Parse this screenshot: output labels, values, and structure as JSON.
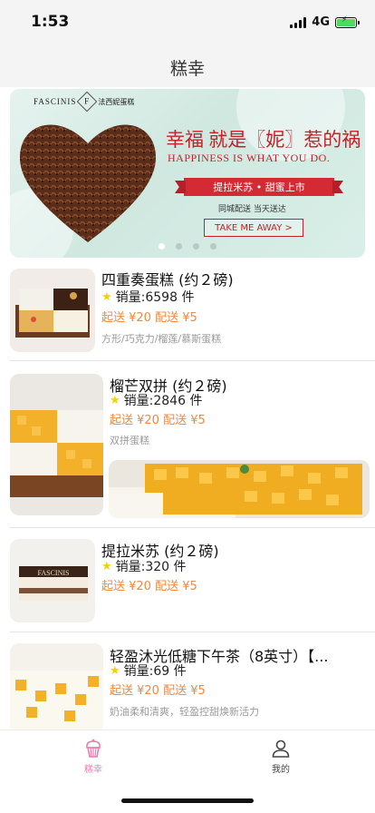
{
  "status_bar": {
    "time": "1:53",
    "network": "4G",
    "battery_level": 0.95,
    "charging": true
  },
  "nav": {
    "title": "糕幸"
  },
  "banner": {
    "brand_en": "FASCINIS",
    "brand_mark": "F",
    "brand_cn": "法西妮蛋糕",
    "slogan": "幸福 就是〖妮〗惹的祸",
    "slogan_en": "HAPPINESS IS WHAT YOU DO.",
    "ribbon": "提拉米苏 • 甜蜜上市",
    "delivery": "同城配送 当天送达",
    "button": "TAKE ME AWAY >",
    "page_count": 4,
    "active_page": 1,
    "colors": {
      "accent": "#c8202a",
      "background": "#d6ede6"
    }
  },
  "products": [
    {
      "title": "四重奏蛋糕 (约２磅)",
      "sales": "销量:6598 件",
      "price": "起送 ¥20 配送 ¥5",
      "tags": "方形/巧克力/榴莲/慕斯蛋糕",
      "image": "square-quartet-cake"
    },
    {
      "title": "榴芒双拼 (约２磅)",
      "sales": "销量:2846 件",
      "price": "起送 ¥20 配送 ¥5",
      "tags": "双拼蛋糕",
      "image": "durian-mango-cake"
    },
    {
      "title": "提拉米苏 (约２磅)",
      "sales": "销量:320 件",
      "price": "起送 ¥20 配送 ¥5",
      "tags": "",
      "image": "tiramisu-cake"
    },
    {
      "title": "轻盈沐光低糖下午茶（8英寸）【...",
      "sales": "销量:69 件",
      "price": "起送 ¥20 配送 ¥5",
      "tags": "奶油柔和清爽，轻盈控甜焕新活力",
      "image": "mango-fruit-cake"
    }
  ],
  "tabs": [
    {
      "label": "糕幸",
      "icon": "cupcake-icon",
      "active": true
    },
    {
      "label": "我的",
      "icon": "user-icon",
      "active": false
    }
  ],
  "colors": {
    "price": "#f0883e",
    "tab_active": "#f07ab0",
    "star": "#f5d100"
  }
}
